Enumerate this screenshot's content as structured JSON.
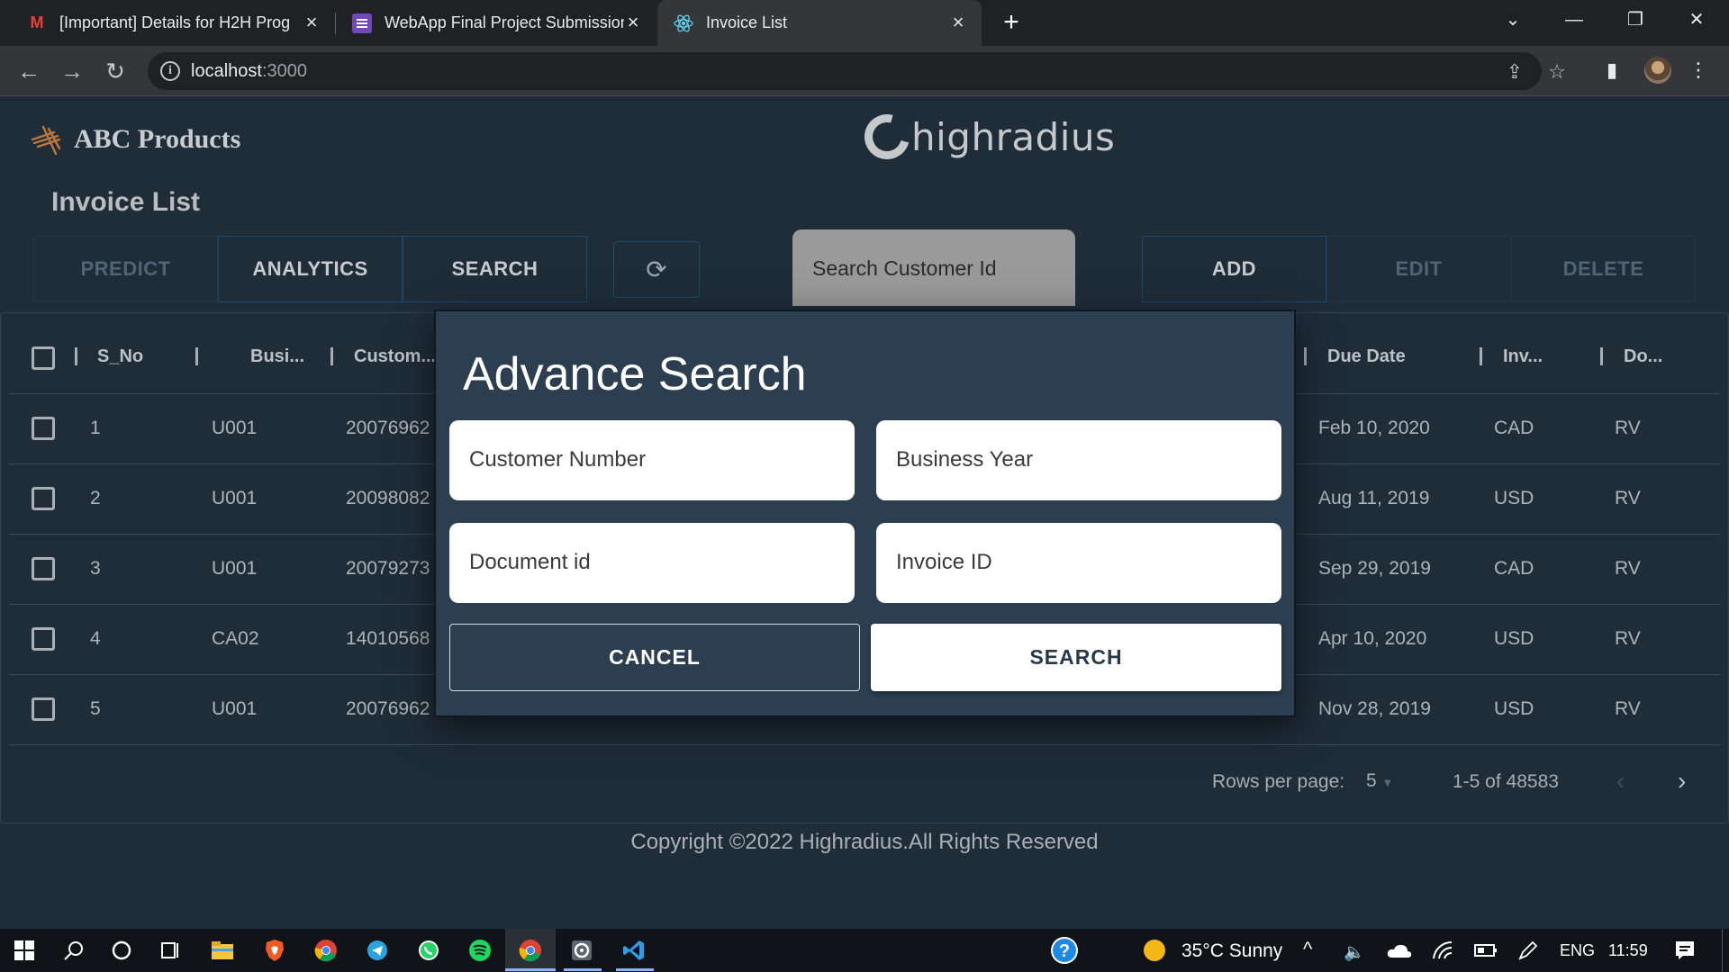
{
  "browser": {
    "tabs": [
      {
        "title": "[Important] Details for H2H Prog",
        "icon": "gmail-icon"
      },
      {
        "title": "WebApp Final Project Submission",
        "icon": "forms-icon"
      },
      {
        "title": "Invoice List",
        "icon": "react-icon"
      }
    ],
    "url_host": "localhost",
    "url_port": ":3000"
  },
  "app": {
    "brand": "ABC Products",
    "partner_logo": "highradius",
    "page_title": "Invoice List",
    "left_buttons": [
      "PREDICT",
      "ANALYTICS",
      "SEARCH"
    ],
    "search_placeholder": "Search Customer Id",
    "right_buttons": [
      "ADD",
      "EDIT",
      "DELETE"
    ]
  },
  "table": {
    "left_headers": [
      "S_No",
      "Busi...",
      "Custom..."
    ],
    "right_headers": [
      "Due Date",
      "Inv...",
      "Do..."
    ],
    "rows": [
      {
        "sno": "1",
        "business": "U001",
        "customer": "20076962",
        "due_date": "Feb 10, 2020",
        "currency": "CAD",
        "doc_type": "RV"
      },
      {
        "sno": "2",
        "business": "U001",
        "customer": "20098082",
        "due_date": "Aug 11, 2019",
        "currency": "USD",
        "doc_type": "RV"
      },
      {
        "sno": "3",
        "business": "U001",
        "customer": "20079273",
        "due_date": "Sep 29, 2019",
        "currency": "CAD",
        "doc_type": "RV"
      },
      {
        "sno": "4",
        "business": "CA02",
        "customer": "14010568",
        "due_date": "Apr 10, 2020",
        "currency": "USD",
        "doc_type": "RV"
      },
      {
        "sno": "5",
        "business": "U001",
        "customer": "20076962",
        "due_date": "Nov 28, 2019",
        "currency": "USD",
        "doc_type": "RV"
      }
    ],
    "pagination": {
      "rows_per_page_label": "Rows per page:",
      "rows_per_page": "5",
      "range": "1-5 of 48583"
    }
  },
  "footer": "Copyright ©2022 Highradius.All Rights Reserved",
  "modal": {
    "title": "Advance Search",
    "fields": [
      "Customer Number",
      "Business Year",
      "Document id",
      "Invoice ID"
    ],
    "cancel_label": "CANCEL",
    "search_label": "SEARCH"
  },
  "taskbar": {
    "weather": "35°C  Sunny",
    "lang": "ENG",
    "time": "11:59"
  }
}
